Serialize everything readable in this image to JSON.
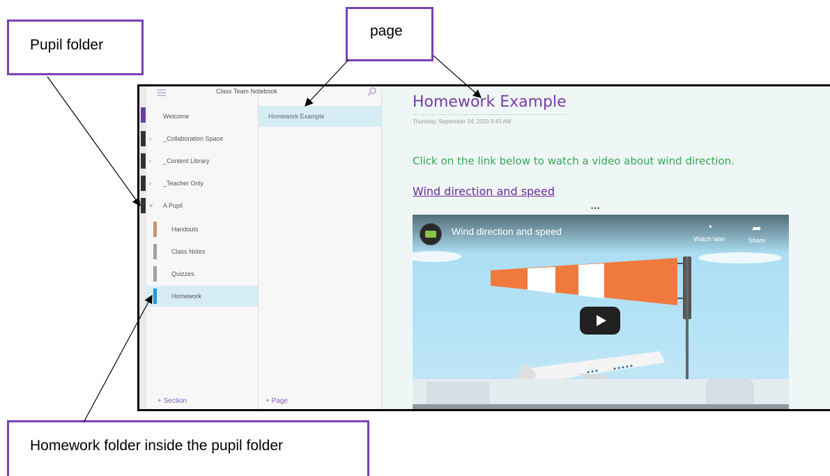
{
  "annotations": {
    "pupil_folder": "Pupil folder",
    "page": "page",
    "homework_folder": "Homework folder inside the pupil folder"
  },
  "notebook": {
    "title": "Class Team Notebook",
    "add_section": "+ Section",
    "add_page": "+ Page"
  },
  "sections": [
    {
      "label": "Welcome",
      "color": "#6b3fa0"
    },
    {
      "label": "_Collaboration Space",
      "color": "#333333",
      "expandable": true
    },
    {
      "label": "_Content Library",
      "color": "#333333",
      "expandable": true
    },
    {
      "label": "_Teacher Only",
      "color": "#333333",
      "expandable": true
    },
    {
      "label": "A Pupil",
      "color": "#333333",
      "expanded": true
    },
    {
      "label": "Handouts",
      "color": "#c8946a"
    },
    {
      "label": "Class Notes",
      "color": "#a0a0a0"
    },
    {
      "label": "Quizzes",
      "color": "#a0a0a0"
    },
    {
      "label": "Homework",
      "color": "#1a9bd7",
      "selected": true
    }
  ],
  "pages": [
    {
      "label": "Homework Example",
      "selected": true
    }
  ],
  "page": {
    "title": "Homework Example",
    "date": "Thursday, September 24, 2020   9:43 AM",
    "instruction": "Click on the link below to watch a video about wind direction.",
    "link_text": "Wind direction and speed"
  },
  "video": {
    "title": "Wind direction and speed",
    "watch_later": "Watch later",
    "share": "Share"
  },
  "colors": {
    "callout_border": "#7b3fb5",
    "title": "#7a3ca8",
    "instruction": "#37a852",
    "link": "#6a2c96",
    "selected_bg": "#d6edf6"
  }
}
